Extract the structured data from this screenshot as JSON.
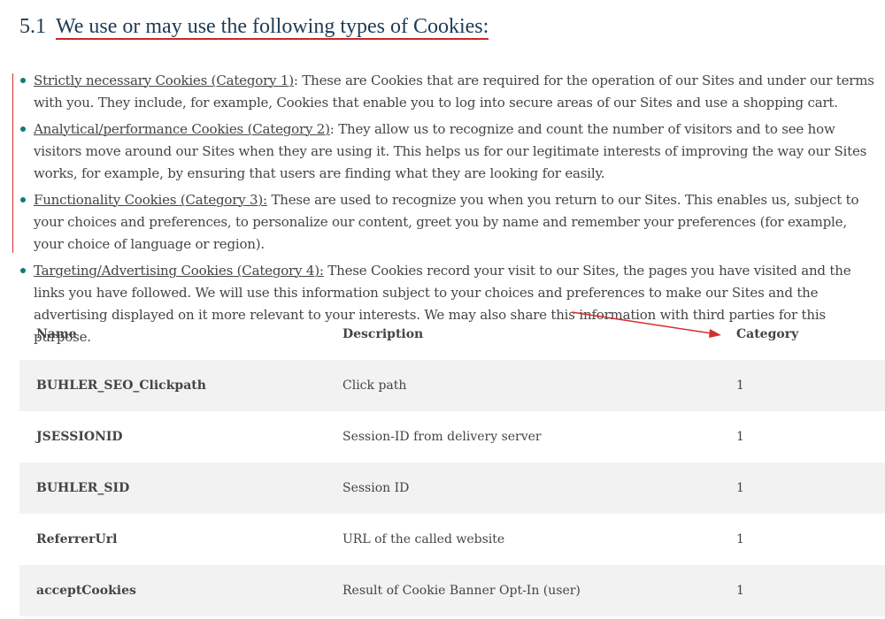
{
  "section": {
    "number": "5.1",
    "title": "We use or may use the following types of Cookies:"
  },
  "cookie_types": [
    {
      "term": "Strictly necessary Cookies (Category 1)",
      "text": ": These are Cookies that are required for the operation of our Sites and under our terms with you. They include, for example, Cookies that enable you to log into secure areas of our Sites and use a shopping cart."
    },
    {
      "term": "Analytical/performance Cookies (Category 2)",
      "text": ": They allow us to recognize and count the number of visitors and to see how visitors move around our Sites when they are using it. This helps us for our legitimate interests of improving the way our Sites works, for example, by ensuring that users are finding what they are looking for easily."
    },
    {
      "term": "Functionality Cookies (Category 3):",
      "text": " These are used to recognize you when you return to our Sites. This enables us, subject to your choices and preferences, to personalize our content, greet you by name and remember your preferences (for example, your choice of language or region)."
    },
    {
      "term": "Targeting/Advertising Cookies (Category 4):",
      "text": " These Cookies record your visit to our Sites, the pages you have visited and the links you have followed. We will use this information subject to your choices and preferences to make our Sites and the advertising displayed on it more relevant to your interests. We may also share this information with third parties for this purpose."
    }
  ],
  "table": {
    "headers": {
      "name": "Name",
      "description": "Description",
      "category": "Category"
    },
    "rows": [
      {
        "name": "BUHLER_SEO_Clickpath",
        "description": "Click path",
        "category": "1"
      },
      {
        "name": "JSESSIONID",
        "description": "Session-ID from delivery server",
        "category": "1"
      },
      {
        "name": "BUHLER_SID",
        "description": "Session ID",
        "category": "1"
      },
      {
        "name": "ReferrerUrl",
        "description": "URL of the called website",
        "category": "1"
      },
      {
        "name": "acceptCookies",
        "description": "Result of Cookie Banner Opt-In (user)",
        "category": "1"
      }
    ]
  },
  "colors": {
    "heading": "#1d3b55",
    "annotation_red": "#d32f2f",
    "bullet": "#0f7c72",
    "row_shade": "#f2f2f2"
  }
}
